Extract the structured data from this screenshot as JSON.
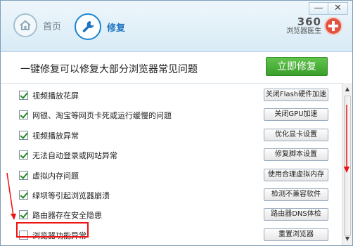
{
  "window": {
    "min_label": "—",
    "close_label": "✕"
  },
  "nav": {
    "home": {
      "label": "首页",
      "icon": "home-icon"
    },
    "repair": {
      "label": "修复",
      "icon": "wrench-icon"
    }
  },
  "logo": {
    "brand": "360",
    "subtitle": "浏览器医生",
    "icon": "medical-cross-icon"
  },
  "banner": {
    "title": "一键修复可以修复大部分浏览器常见问题",
    "fix_button": "立即修复"
  },
  "items": [
    {
      "label": "视频播放花屏",
      "checked": true,
      "button": "关闭Flash硬件加速"
    },
    {
      "label": "网银、淘宝等网页卡死或运行缓慢的问题",
      "checked": true,
      "button": "关闭GPU加速"
    },
    {
      "label": "视频播放异常",
      "checked": true,
      "button": "优化显卡设置"
    },
    {
      "label": "无法自动登录或网站异常",
      "checked": true,
      "button": "修复脚本设置"
    },
    {
      "label": "虚拟内存问题",
      "checked": true,
      "button": "使用合理虚拟内存"
    },
    {
      "label": "绿坝等引起浏览器崩溃",
      "checked": true,
      "button": "检测不兼容软件"
    },
    {
      "label": "路由器存在安全隐患",
      "checked": true,
      "button": "路由器DNS体检"
    },
    {
      "label": "浏览器功能异常",
      "checked": false,
      "button": "重置浏览器"
    }
  ],
  "colors": {
    "accent": "#1d74c0",
    "fix_button": "#4cb43a",
    "highlight": "#e11111"
  }
}
